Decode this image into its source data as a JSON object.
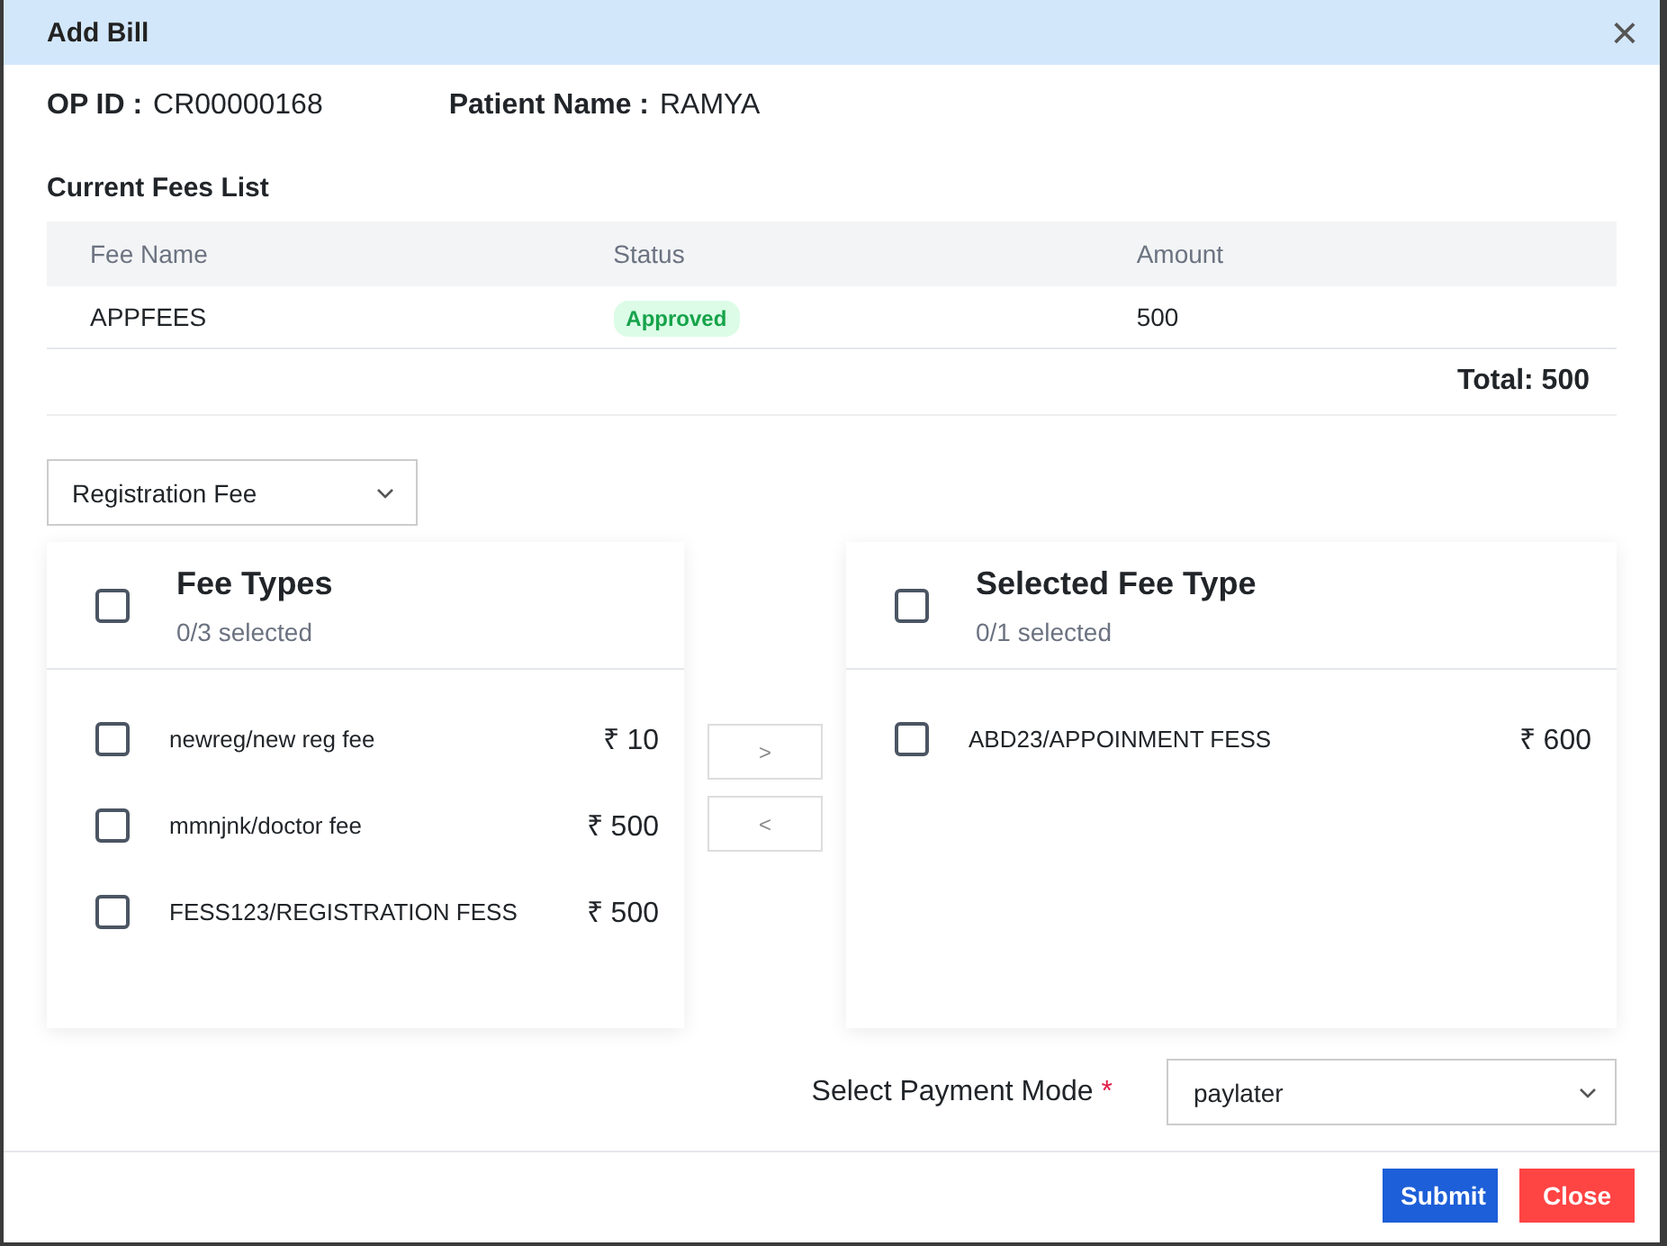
{
  "dialog": {
    "title": "Add Bill",
    "close": "×"
  },
  "patient": [
    {
      "label": "OP ID :",
      "value": "CR00000168"
    },
    {
      "label": "Patient Name :",
      "value": "RAMYA"
    }
  ],
  "current_fees": {
    "title": "Current Fees List",
    "columns": [
      "Fee Name",
      "Status",
      "Amount"
    ],
    "rows": [
      {
        "fee_name": "APPFEES",
        "status": "Approved",
        "amount": "500"
      }
    ],
    "total": "Total: 500"
  },
  "fee_category": {
    "value": "Registration Fee"
  },
  "lists": [
    {
      "title": "Fee Types",
      "count": "0/3 selected",
      "checked": false,
      "items": [
        {
          "label": "newreg/new reg fee",
          "amount": "₹ 10",
          "checked": false
        },
        {
          "label": "mmnjnk/doctor fee",
          "amount": "₹ 500",
          "checked": false
        },
        {
          "label": "FESS123/REGISTRATION FESS",
          "amount": "₹ 500",
          "checked": false
        }
      ]
    },
    {
      "title": "Selected Fee Type",
      "count": "0/1 selected",
      "checked": false,
      "items": [
        {
          "label": "ABD23/APPOINMENT FESS",
          "amount": "₹ 600",
          "checked": false
        }
      ]
    }
  ],
  "transfer_buttons": [
    ">",
    "<"
  ],
  "payment_mode": {
    "label": "Select Payment Mode",
    "required_mark": "*",
    "value": "paylater"
  },
  "buttons": [
    {
      "label": "Submit",
      "kind": "primary"
    },
    {
      "label": "Close",
      "kind": "danger"
    }
  ]
}
